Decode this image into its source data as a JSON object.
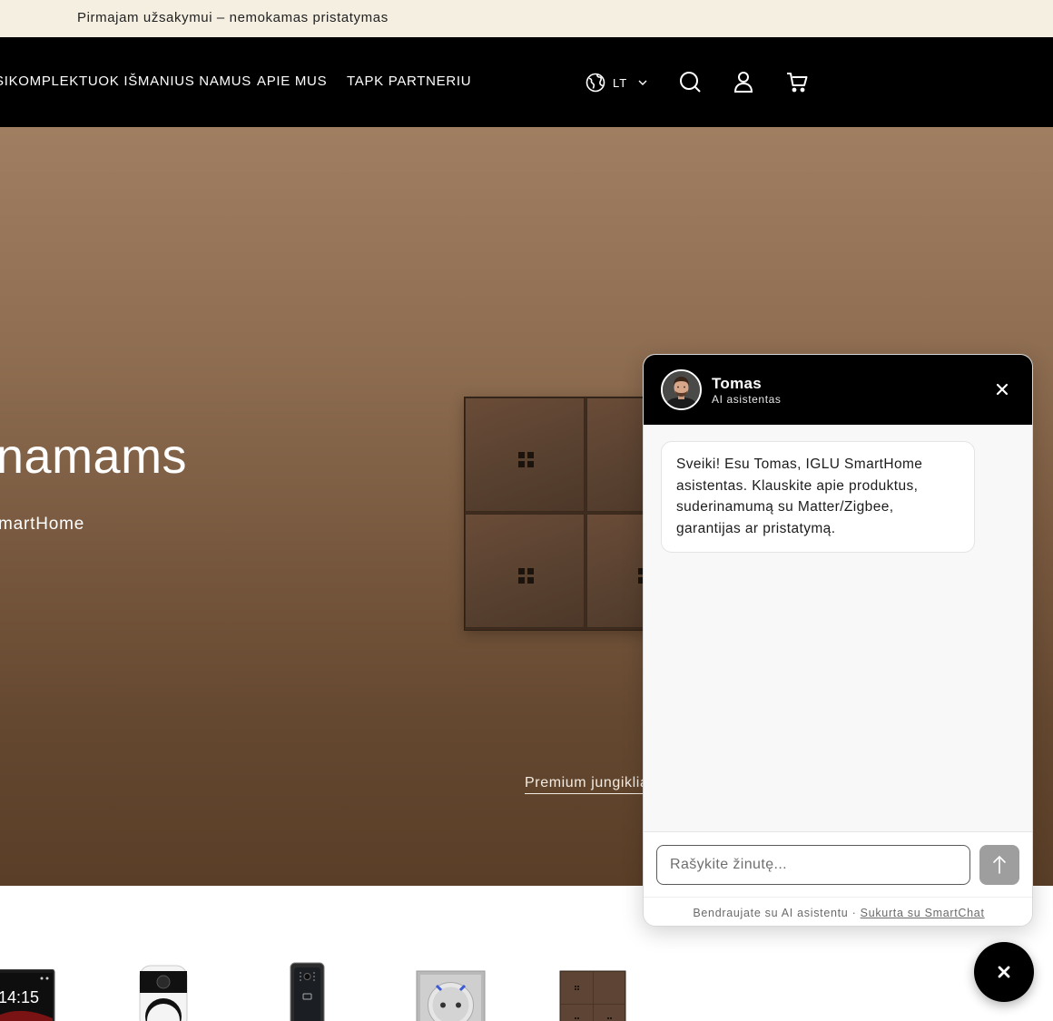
{
  "announcement": {
    "text": "Pirmajam užsakymui – nemokamas pristatymas"
  },
  "nav": {
    "links": [
      "SIKOMPLEKTUOK IŠMANIUS NAMUS",
      "APIE MUS",
      "TAPK PARTNERIU"
    ],
    "language": "LT",
    "icons": [
      "globe-icon",
      "chevron-down-icon",
      "search-icon",
      "account-icon",
      "cart-icon"
    ]
  },
  "hero": {
    "heading": "namams",
    "subheading": "martHome",
    "link": "Premium jungiklia"
  },
  "chat": {
    "agent_name": "Tomas",
    "agent_role": "AI asistentas",
    "message": "Sveiki! Esu Tomas, IGLU SmartHome asistentas. Klauskite apie produktus, suderinamumą su Matter/Zigbee, garantijas ar pristatymą.",
    "input_placeholder": "Rašykite žinutę...",
    "footer_text": "Bendraujate su AI asistentu · ",
    "footer_link": "Sukurta su SmartChat"
  },
  "products": {
    "thumb_clock_text": "14:15"
  },
  "colors": {
    "announce_bg": "#f5efe2",
    "nav_bg": "#000000",
    "chat_header_bg": "#000000",
    "send_button": "#9e9e9e"
  }
}
